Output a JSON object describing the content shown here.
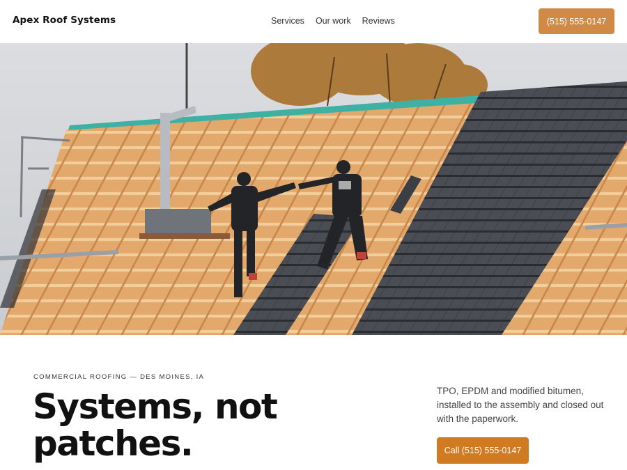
{
  "header": {
    "brand": "Apex Roof Systems",
    "nav": [
      "Services",
      "Our work",
      "Reviews"
    ],
    "phone_button": "(515) 555-0147"
  },
  "hero": {
    "image_description_icon": "roofers-on-pitched-roof-photo"
  },
  "intro": {
    "eyebrow": "COMMERCIAL ROOFING — DES MOINES, IA",
    "headline": "Systems, not patches.",
    "description": "TPO, EPDM and modified bitumen, installed to the assembly and closed out with the paperwork.",
    "cta": "Call (515) 555-0147"
  },
  "colors": {
    "accent_light": "#d08a45",
    "accent": "#d07a22",
    "text": "#111111"
  }
}
